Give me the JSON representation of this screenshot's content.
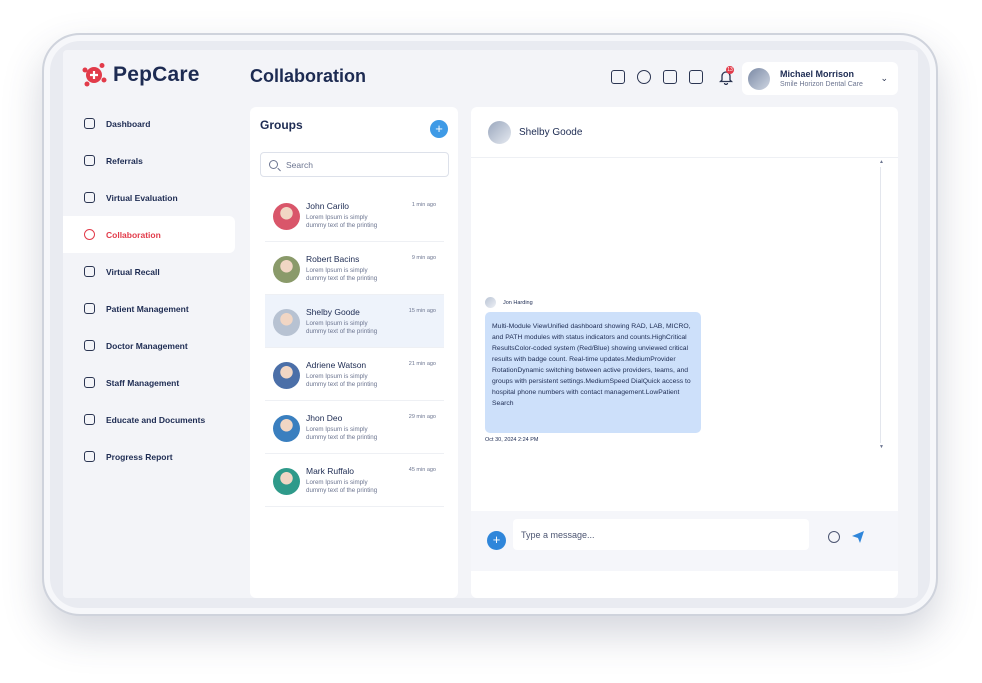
{
  "app": {
    "name": "PepCare",
    "page_title": "Collaboration"
  },
  "header": {
    "icons": [
      "monitor-icon",
      "camera-icon",
      "record-icon",
      "mail-icon"
    ],
    "bell_badge": "13",
    "user": {
      "name": "Michael Morrison",
      "clinic": "Smile Horizon Dental Care"
    }
  },
  "sidebar": {
    "items": [
      {
        "label": "Dashboard",
        "icon": "dashboard-icon"
      },
      {
        "label": "Referrals",
        "icon": "referrals-icon"
      },
      {
        "label": "Virtual Evaluation",
        "icon": "heart-icon"
      },
      {
        "label": "Collaboration",
        "icon": "collaboration-icon",
        "active": true
      },
      {
        "label": "Virtual Recall",
        "icon": "recall-icon"
      },
      {
        "label": "Patient Management",
        "icon": "patient-icon"
      },
      {
        "label": "Doctor Management",
        "icon": "doctor-icon"
      },
      {
        "label": "Staff Management",
        "icon": "staff-icon"
      },
      {
        "label": "Educate and Documents",
        "icon": "documents-icon"
      },
      {
        "label": "Progress Report",
        "icon": "report-icon"
      }
    ]
  },
  "groups": {
    "title": "Groups",
    "search_placeholder": "Search",
    "contacts": [
      {
        "name": "John Carilo",
        "message": "Lorem Ipsum is simply dummy text of the printing",
        "time": "1 min ago",
        "color": "#d9566a"
      },
      {
        "name": "Robert Bacins",
        "message": "Lorem Ipsum is simply dummy text of the printing",
        "time": "9 min ago",
        "color": "#8a9a6a"
      },
      {
        "name": "Shelby Goode",
        "message": "Lorem Ipsum is simply dummy text of the printing",
        "time": "15 min ago",
        "color": "#b7c2d2",
        "active": true
      },
      {
        "name": "Adriene Watson",
        "message": "Lorem Ipsum is simply dummy text of the printing",
        "time": "21 min ago",
        "color": "#4b6fa8"
      },
      {
        "name": "Jhon Deo",
        "message": "Lorem Ipsum is simply dummy text of the printing",
        "time": "29 min ago",
        "color": "#3a7fbf"
      },
      {
        "name": "Mark Ruffalo",
        "message": "Lorem Ipsum is simply dummy text of the printing",
        "time": "45 min ago",
        "color": "#2f9a8a"
      }
    ]
  },
  "chat": {
    "contact_name": "Shelby Goode",
    "message": {
      "sender": "Jon Harding",
      "text": "Multi-Module ViewUnified dashboard showing RAD, LAB, MICRO, and PATH modules with status indicators and counts.HighCritical ResultsColor-coded system (Red/Blue) showing unviewed critical results with badge count. Real-time updates.MediumProvider RotationDynamic switching between active providers, teams, and groups with persistent settings.MediumSpeed DialQuick access to hospital phone numbers with contact management.LowPatient Search",
      "time": "Oct 30, 2024 2:24 PM"
    },
    "composer_placeholder": "Type a message..."
  },
  "colors": {
    "accent": "#e23b4a",
    "primary": "#3e9ae6",
    "bubble": "#cde0fa"
  }
}
